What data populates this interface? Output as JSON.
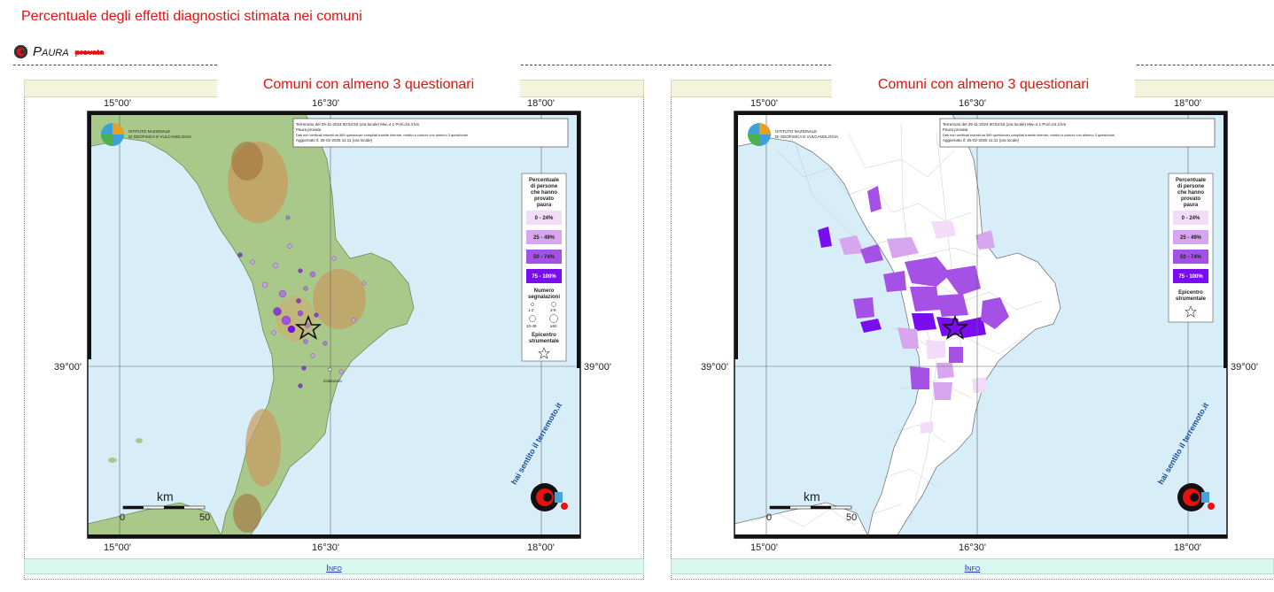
{
  "page_title": "Percentuale degli effetti diagnostici stimata nei comuni",
  "section": {
    "label": "Paura",
    "strike": "provata"
  },
  "panels": [
    {
      "title": "Comuni con almeno 3 questionari",
      "info": "Info"
    },
    {
      "title": "Comuni con almeno 3 questionari",
      "info": "Info"
    }
  ],
  "map": {
    "lon_labels": [
      "15°00'",
      "16°30'",
      "18°00'"
    ],
    "lat_label": "39°00'",
    "logo_line1": "ISTITUTO NAZIONALE",
    "logo_line2": "DI GEOFISICA E VULCANOLOGIA",
    "header_line1": "Terremoto del 29-11-2024 00:54:53 (ora locale) Mw=4.1 Prof=24.3 km",
    "header_line2": "Paura provata",
    "header_line3": "Dati non verificati estratti da 569 questionari compilati tramite internet, relativi a comuni con almeno 3 questionari",
    "header_line4": "Aggiornato il: 25-02-2025 11:11 (ora locale)",
    "legend_title": [
      "Percentuale",
      "di persone",
      "che hanno",
      "provato",
      "paura"
    ],
    "legend_classes": [
      "0 - 24%",
      "25 - 49%",
      "50 - 74%",
      "75 - 100%"
    ],
    "legend_count_title": [
      "Numero",
      "segnalazioni"
    ],
    "legend_counts": [
      "1-2",
      "3-9",
      "10-49",
      "≥50"
    ],
    "legend_epi": [
      "Epicentro",
      "strumentale"
    ],
    "city": "Catanzaro",
    "scale_unit": "km",
    "scale_min": "0",
    "scale_max": "50",
    "watermark": "hai sentito il terremoto.it"
  },
  "colors": {
    "accent_red": "#e8110f",
    "class_0": "#f2dcf7",
    "class_1": "#d7a6ee",
    "class_2": "#a651e6",
    "class_3": "#7a0df0",
    "sea": "#d7eef9"
  }
}
